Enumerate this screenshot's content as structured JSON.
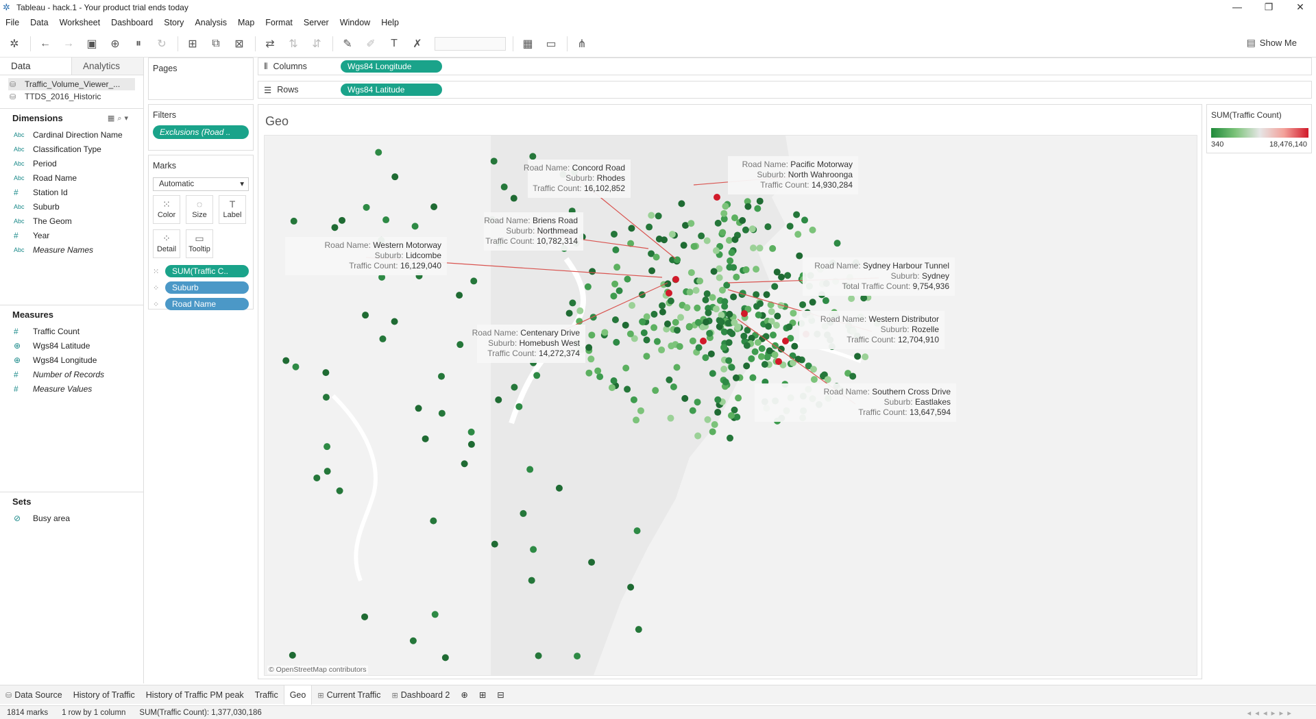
{
  "app": {
    "title": "Tableau - hack.1 - Your product trial ends today",
    "menu": [
      "File",
      "Data",
      "Worksheet",
      "Dashboard",
      "Story",
      "Analysis",
      "Map",
      "Format",
      "Server",
      "Window",
      "Help"
    ],
    "show_me": "Show Me"
  },
  "data_pane": {
    "tabs": [
      "Data",
      "Analytics"
    ],
    "sources": [
      "Traffic_Volume_Viewer_...",
      "TTDS_2016_Historic"
    ],
    "dimensions_title": "Dimensions",
    "dimensions": [
      {
        "type": "Abc",
        "name": "Cardinal Direction Name"
      },
      {
        "type": "Abc",
        "name": "Classification Type"
      },
      {
        "type": "Abc",
        "name": "Period"
      },
      {
        "type": "Abc",
        "name": "Road Name"
      },
      {
        "type": "#",
        "name": "Station Id"
      },
      {
        "type": "Abc",
        "name": "Suburb"
      },
      {
        "type": "Abc",
        "name": "The Geom"
      },
      {
        "type": "#",
        "name": "Year"
      },
      {
        "type": "Abc",
        "name": "Measure Names"
      }
    ],
    "measures_title": "Measures",
    "measures": [
      {
        "type": "#",
        "name": "Traffic Count"
      },
      {
        "type": "geo",
        "name": "Wgs84 Latitude"
      },
      {
        "type": "geo",
        "name": "Wgs84 Longitude"
      },
      {
        "type": "=#",
        "name": "Number of Records"
      },
      {
        "type": "#",
        "name": "Measure Values"
      }
    ],
    "sets_title": "Sets",
    "sets": [
      "Busy area"
    ]
  },
  "cards": {
    "pages": "Pages",
    "filters": "Filters",
    "filter_pill": "Exclusions (Road ..",
    "marks": "Marks",
    "mark_type": "Automatic",
    "mark_buttons": [
      "Color",
      "Size",
      "Label",
      "Detail",
      "Tooltip"
    ],
    "mark_pills": [
      "SUM(Traffic C..",
      "Suburb",
      "Road Name"
    ]
  },
  "shelves": {
    "columns_label": "Columns",
    "columns_pill": "Wgs84 Longitude",
    "rows_label": "Rows",
    "rows_pill": "Wgs84 Latitude"
  },
  "view": {
    "title": "Geo",
    "attribution": "© OpenStreetMap contributors"
  },
  "legend": {
    "title": "SUM(Traffic Count)",
    "min": "340",
    "max": "18,476,140"
  },
  "annotations": [
    {
      "rows": [
        [
          "Road Name:",
          "Concord Road"
        ],
        [
          "Suburb:",
          "Rhodes"
        ],
        [
          "Traffic Count:",
          "16,102,852"
        ]
      ]
    },
    {
      "rows": [
        [
          "Road Name:",
          "Pacific Motorway"
        ],
        [
          "Suburb:",
          "North Wahroonga"
        ],
        [
          "Traffic Count:",
          "14,930,284"
        ]
      ]
    },
    {
      "rows": [
        [
          "Road Name:",
          "Briens Road"
        ],
        [
          "Suburb:",
          "Northmead"
        ],
        [
          "Traffic Count:",
          "10,782,314"
        ]
      ]
    },
    {
      "rows": [
        [
          "Road Name:",
          "Western Motorway"
        ],
        [
          "Suburb:",
          "Lidcombe"
        ],
        [
          "Traffic Count:",
          "16,129,040"
        ]
      ]
    },
    {
      "rows": [
        [
          "Road Name:",
          "Sydney Harbour Tunnel"
        ],
        [
          "Suburb:",
          "Sydney"
        ],
        [
          "Total Traffic Count:",
          "9,754,936"
        ]
      ]
    },
    {
      "rows": [
        [
          "Road Name:",
          "Western Distributor"
        ],
        [
          "Suburb:",
          "Rozelle"
        ],
        [
          "Traffic Count:",
          "12,704,910"
        ]
      ]
    },
    {
      "rows": [
        [
          "Road Name:",
          "Centenary Drive"
        ],
        [
          "Suburb:",
          "Homebush West"
        ],
        [
          "Traffic Count:",
          "14,272,374"
        ]
      ]
    },
    {
      "rows": [
        [
          "Road Name:",
          "Southern Cross Drive"
        ],
        [
          "Suburb:",
          "Eastlakes"
        ],
        [
          "Traffic Count:",
          "13,647,594"
        ]
      ]
    }
  ],
  "sheet_tabs": [
    "Data Source",
    "History of Traffic",
    "History of Traffic PM peak",
    "Traffic",
    "Geo",
    "Current Traffic",
    "Dashboard 2"
  ],
  "active_tab": "Geo",
  "status": {
    "marks": "1814 marks",
    "rows": "1 row by 1 column",
    "sum": "SUM(Traffic Count): 1,377,030,186"
  },
  "colors": {
    "accent_pill": "#1aa38a",
    "blue_pill": "#4b98c7",
    "high": "#d11a2a",
    "low": "#1f6b33"
  }
}
